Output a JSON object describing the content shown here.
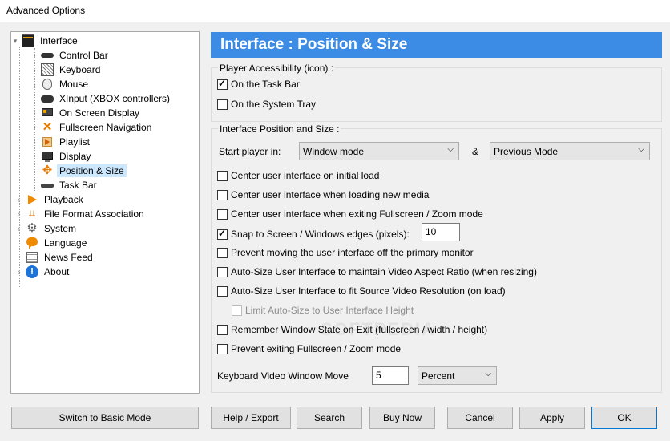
{
  "window": {
    "title": "Advanced Options"
  },
  "tree": {
    "items": [
      {
        "label": "Interface",
        "icon": "interface-icon",
        "expanded": true
      },
      {
        "label": "Control Bar",
        "icon": "control-bar-icon"
      },
      {
        "label": "Keyboard",
        "icon": "keyboard-icon"
      },
      {
        "label": "Mouse",
        "icon": "mouse-icon"
      },
      {
        "label": "XInput (XBOX controllers)",
        "icon": "gamepad-icon"
      },
      {
        "label": "On Screen Display",
        "icon": "osd-icon"
      },
      {
        "label": "Fullscreen Navigation",
        "icon": "fullscreen-icon"
      },
      {
        "label": "Playlist",
        "icon": "playlist-icon"
      },
      {
        "label": "Display",
        "icon": "display-icon"
      },
      {
        "label": "Position & Size",
        "icon": "position-icon",
        "selected": true
      },
      {
        "label": "Task Bar",
        "icon": "taskbar-icon"
      },
      {
        "label": "Playback",
        "icon": "playback-icon"
      },
      {
        "label": "File Format Association",
        "icon": "file-association-icon"
      },
      {
        "label": "System",
        "icon": "gear-icon"
      },
      {
        "label": "Language",
        "icon": "language-icon"
      },
      {
        "label": "News Feed",
        "icon": "news-icon"
      },
      {
        "label": "About",
        "icon": "info-icon"
      }
    ]
  },
  "header": {
    "title": "Interface : Position & Size"
  },
  "accessibility": {
    "title": "Player Accessibility (icon) :",
    "task_bar": {
      "label": "On the Task Bar",
      "checked": true
    },
    "system_tray": {
      "label": "On the System Tray",
      "checked": false
    }
  },
  "position": {
    "title": "Interface Position and Size :",
    "start_label": "Start player in:",
    "start_mode": "Window mode",
    "amp": "&",
    "second_mode": "Previous Mode",
    "options": [
      {
        "label": "Center user interface on initial load",
        "checked": false
      },
      {
        "label": "Center user interface when loading new media",
        "checked": false
      },
      {
        "label": "Center user interface when exiting Fullscreen / Zoom mode",
        "checked": false
      },
      {
        "label": "Snap to Screen / Windows edges (pixels):",
        "checked": true
      },
      {
        "label": "Prevent moving the user interface off the primary monitor",
        "checked": false
      },
      {
        "label": "Auto-Size User Interface to maintain Video Aspect Ratio (when resizing)",
        "checked": false
      },
      {
        "label": "Auto-Size User Interface to fit Source Video Resolution (on load)",
        "checked": false
      },
      {
        "label": "Limit Auto-Size to User Interface Height",
        "checked": false,
        "disabled": true
      },
      {
        "label": "Remember Window State on Exit (fullscreen / width / height)",
        "checked": false
      },
      {
        "label": "Prevent exiting Fullscreen / Zoom mode",
        "checked": false
      }
    ],
    "snap_value": "10",
    "kb_move_label": "Keyboard Video Window Move",
    "kb_move_value": "5",
    "kb_move_unit": "Percent"
  },
  "watermark": "SOFTPEDIA",
  "buttons": {
    "basic_mode": "Switch to Basic Mode",
    "help": "Help / Export",
    "search": "Search",
    "buy": "Buy Now",
    "cancel": "Cancel",
    "apply": "Apply",
    "ok": "OK"
  },
  "colors": {
    "header_bg": "#3c8be4",
    "selection": "#cce8ff"
  }
}
